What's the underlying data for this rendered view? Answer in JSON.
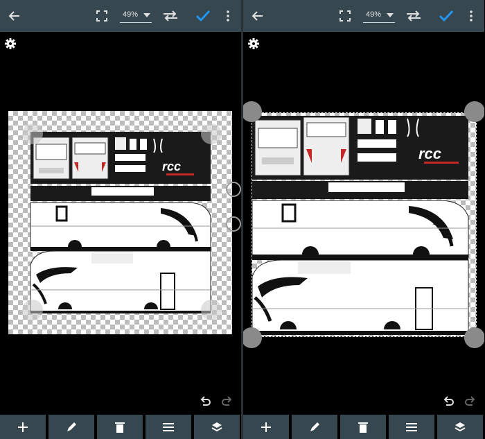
{
  "toolbar": {
    "zoom_value": "49%",
    "accent_color": "#2196f3",
    "bar_color": "#37474f"
  },
  "icons": {
    "back": "arrow-left-icon",
    "fullscreen": "fullscreen-icon",
    "zoom_dropdown": "caret-down-icon",
    "swap": "swap-arrows-icon",
    "confirm": "check-icon",
    "menu": "more-vert-icon",
    "settings": "gear-icon",
    "undo": "undo-icon",
    "redo": "redo-icon"
  },
  "bottom_bar": [
    {
      "name": "add",
      "icon": "plus-icon"
    },
    {
      "name": "edit",
      "icon": "pencil-icon"
    },
    {
      "name": "delete",
      "icon": "trash-icon"
    },
    {
      "name": "layers-menu",
      "icon": "menu-lines-icon"
    },
    {
      "name": "layers",
      "icon": "layers-icon"
    }
  ],
  "canvas": {
    "logo_text": "rcc",
    "background": "transparent-checkerboard"
  }
}
